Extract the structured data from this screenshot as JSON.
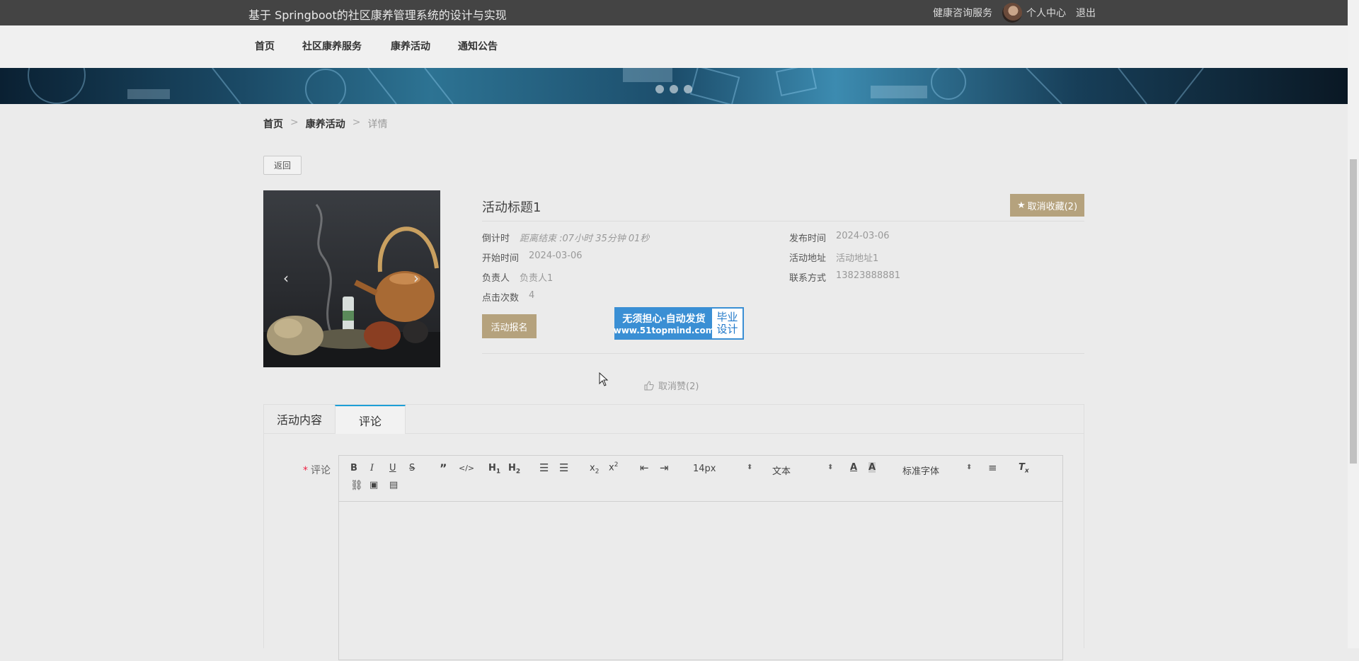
{
  "header": {
    "site_title": "基于 Springboot的社区康养管理系统的设计与实现",
    "links": [
      "健康咨询服务",
      "个人中心",
      "退出"
    ]
  },
  "nav": {
    "items": [
      "首页",
      "社区康养服务",
      "康养活动",
      "通知公告"
    ]
  },
  "breadcrumb": {
    "items": [
      "首页",
      "康养活动",
      "详情"
    ],
    "separator": ">"
  },
  "back_label": "返回",
  "detail": {
    "title": "活动标题1",
    "favorite_label": "取消收藏(2)",
    "countdown_label": "倒计时",
    "countdown_value": "距离结束 :07小时 35分钟 01秒",
    "publish_label": "发布时间",
    "publish_value": "2024-03-06",
    "start_label": "开始时间",
    "start_value": "2024-03-06",
    "address_label": "活动地址",
    "address_value": "活动地址1",
    "owner_label": "负责人",
    "owner_value": "负责人1",
    "contact_label": "联系方式",
    "contact_value": "13823888881",
    "clicks_label": "点击次数",
    "clicks_value": "4",
    "signup_label": "活动报名",
    "like_label": "取消赞(2)"
  },
  "ad": {
    "line1": "无须担心·自动发货",
    "line2": "www.51topmind.com",
    "right1": "毕业",
    "right2": "设计"
  },
  "tabs": [
    "活动内容",
    "评论"
  ],
  "comment": {
    "label": "评论",
    "required_mark": "*",
    "font_size": "14px",
    "text_type": "文本",
    "font_family": "标准字体"
  },
  "colors": {
    "accent_button": "#b5a27d",
    "tab_active": "#1e9fd6",
    "topbar": "#444444"
  }
}
